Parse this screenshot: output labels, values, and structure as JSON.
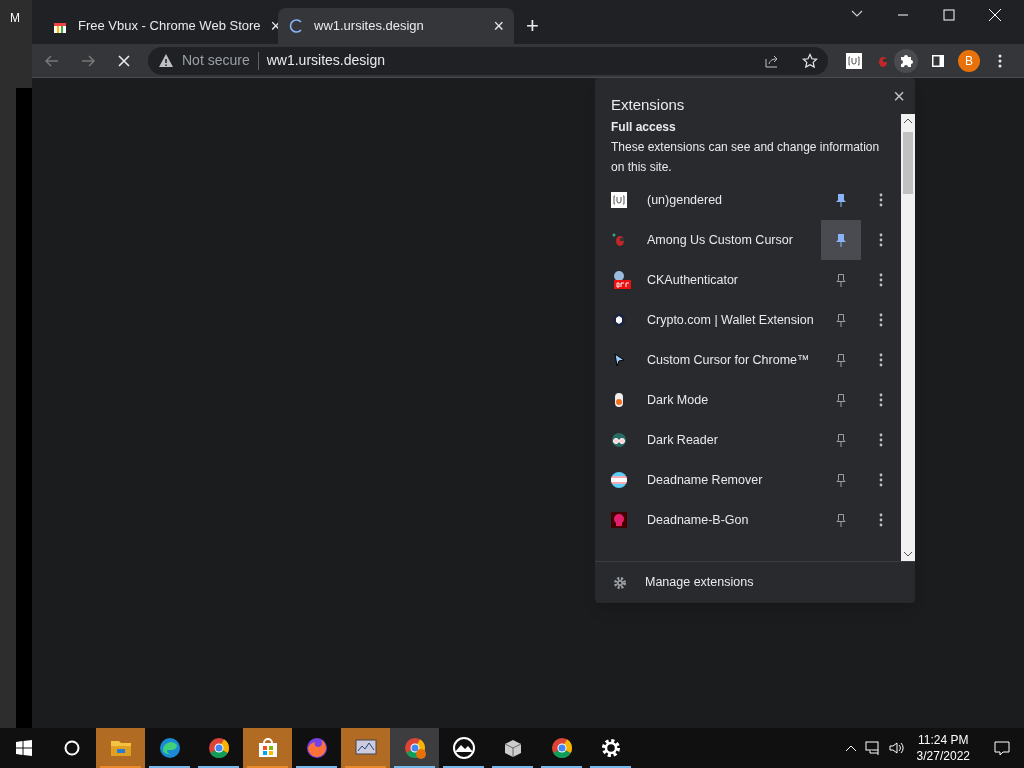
{
  "background_window": {
    "title": "M"
  },
  "tabs": [
    {
      "title": "Free Vbux - Chrome Web Store",
      "close": "×",
      "selected": false,
      "loading": false
    },
    {
      "title": "ww1.ursites.design",
      "close": "×",
      "selected": true,
      "loading": true
    }
  ],
  "new_tab": "+",
  "address_bar": {
    "security": "Not secure",
    "url": "ww1.ursites.design"
  },
  "profile": "B",
  "extensions_popup": {
    "title": "Extensions",
    "close": "×",
    "section_title": "Full access",
    "section_text": "These extensions can see and change information on this site.",
    "items": [
      {
        "name": "(un)gendered",
        "pinned": true,
        "hovered": false
      },
      {
        "name": "Among Us Custom Cursor",
        "pinned": true,
        "hovered": true
      },
      {
        "name": "CKAuthenticator",
        "pinned": false,
        "hovered": false
      },
      {
        "name": "Crypto.com | Wallet Extension",
        "pinned": false,
        "hovered": false
      },
      {
        "name": "Custom Cursor for Chrome™",
        "pinned": false,
        "hovered": false
      },
      {
        "name": "Dark Mode",
        "pinned": false,
        "hovered": false
      },
      {
        "name": "Dark Reader",
        "pinned": false,
        "hovered": false
      },
      {
        "name": "Deadname Remover",
        "pinned": false,
        "hovered": false
      },
      {
        "name": "Deadname-B-Gon",
        "pinned": false,
        "hovered": false
      }
    ],
    "manage": "Manage extensions"
  },
  "taskbar": {
    "apps": [
      {
        "flashing": true,
        "selected": false
      },
      {
        "flashing": false,
        "selected": false
      },
      {
        "flashing": false,
        "selected": false
      },
      {
        "flashing": true,
        "selected": false
      },
      {
        "flashing": false,
        "selected": false
      },
      {
        "flashing": true,
        "selected": false
      },
      {
        "flashing": false,
        "selected": true
      },
      {
        "flashing": false,
        "selected": false
      },
      {
        "flashing": false,
        "selected": false
      },
      {
        "flashing": false,
        "selected": false
      },
      {
        "flashing": false,
        "selected": false
      }
    ],
    "time": "11:24 PM",
    "date": "3/27/2022"
  }
}
